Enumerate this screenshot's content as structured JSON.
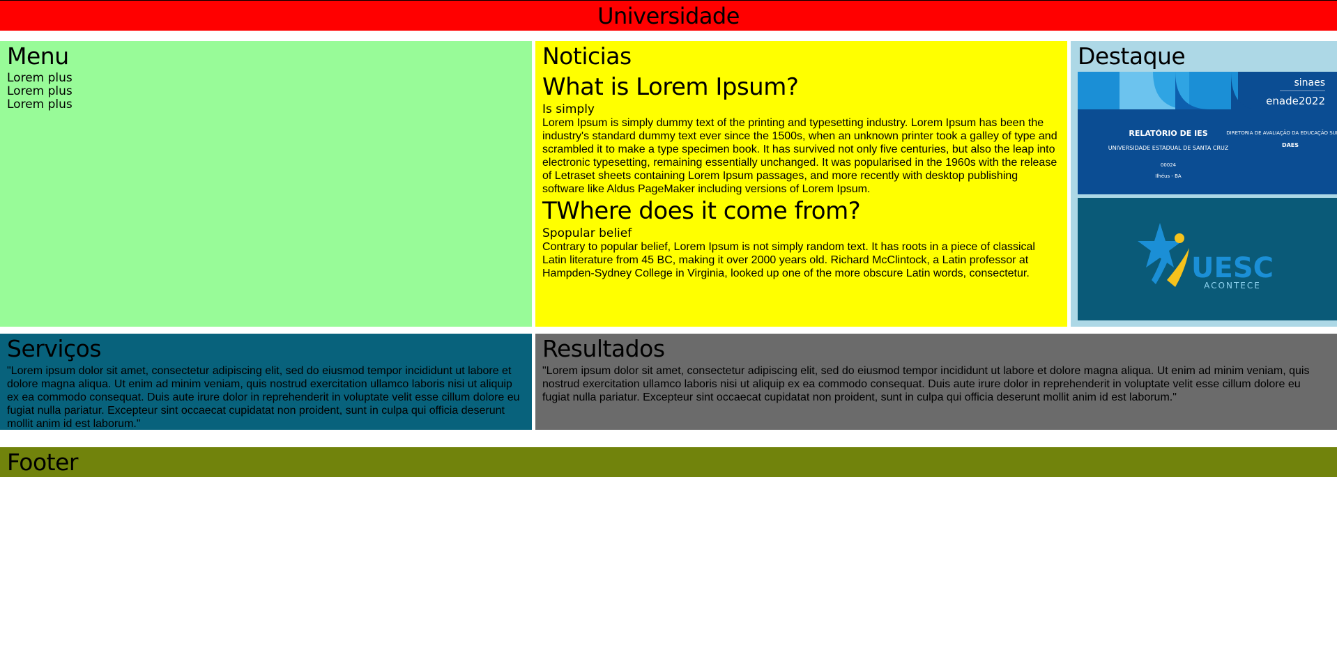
{
  "header": {
    "title": "Universidade"
  },
  "menu": {
    "title": "Menu",
    "items": [
      "Lorem plus",
      "Lorem plus",
      "Lorem plus"
    ]
  },
  "news": {
    "title": "Noticias",
    "articles": [
      {
        "heading": "What is Lorem Ipsum?",
        "subheading": "Is simply",
        "body": "Lorem Ipsum is simply dummy text of the printing and typesetting industry. Lorem Ipsum has been the industry's standard dummy text ever since the 1500s, when an unknown printer took a galley of type and scrambled it to make a type specimen book. It has survived not only five centuries, but also the leap into electronic typesetting, remaining essentially unchanged. It was popularised in the 1960s with the release of Letraset sheets containing Lorem Ipsum passages, and more recently with desktop publishing software like Aldus PageMaker including versions of Lorem Ipsum."
      },
      {
        "heading": "TWhere does it come from?",
        "subheading": "Spopular belief",
        "body": "Contrary to popular belief, Lorem Ipsum is not simply random text. It has roots in a piece of classical Latin literature from 45 BC, making it over 2000 years old. Richard McClintock, a Latin professor at Hampden-Sydney College in Virginia, looked up one of the more obscure Latin words, consectetur."
      }
    ]
  },
  "highlight": {
    "title": "Destaque",
    "report": {
      "brand_top": "sinaes",
      "brand_sub": "enade2022",
      "title": "RELATÓRIO DE IES",
      "institution": "UNIVERSIDADE ESTADUAL DE SANTA CRUZ",
      "code": "00024",
      "location": "Ilhéus - BA",
      "directorate": "DIRETORIA DE AVALIAÇÃO DA EDUCAÇÃO SUPERIOR",
      "directorate_short": "DAES"
    },
    "uesc": {
      "logo_text": "UESC",
      "tagline": "ACONTECE"
    }
  },
  "services": {
    "title": "Serviços",
    "body": "\"Lorem ipsum dolor sit amet, consectetur adipiscing elit, sed do eiusmod tempor incididunt ut labore et dolore magna aliqua. Ut enim ad minim veniam, quis nostrud exercitation ullamco laboris nisi ut aliquip ex ea commodo consequat. Duis aute irure dolor in reprehenderit in voluptate velit esse cillum dolore eu fugiat nulla pariatur. Excepteur sint occaecat cupidatat non proident, sunt in culpa qui officia deserunt mollit anim id est laborum.\""
  },
  "results": {
    "title": "Resultados",
    "body": "\"Lorem ipsum dolor sit amet, consectetur adipiscing elit, sed do eiusmod tempor incididunt ut labore et dolore magna aliqua. Ut enim ad minim veniam, quis nostrud exercitation ullamco laboris nisi ut aliquip ex ea commodo consequat. Duis aute irure dolor in reprehenderit in voluptate velit esse cillum dolore eu fugiat nulla pariatur. Excepteur sint occaecat cupidatat non proident, sunt in culpa qui officia deserunt mollit anim id est laborum.\""
  },
  "footer": {
    "title": "Footer"
  },
  "colors": {
    "header": "#ff0000",
    "menu": "#98fb98",
    "news": "#ffff00",
    "highlight": "#add8e6",
    "services": "#08627c",
    "results": "#6b6b6b",
    "footer": "#71830c"
  }
}
